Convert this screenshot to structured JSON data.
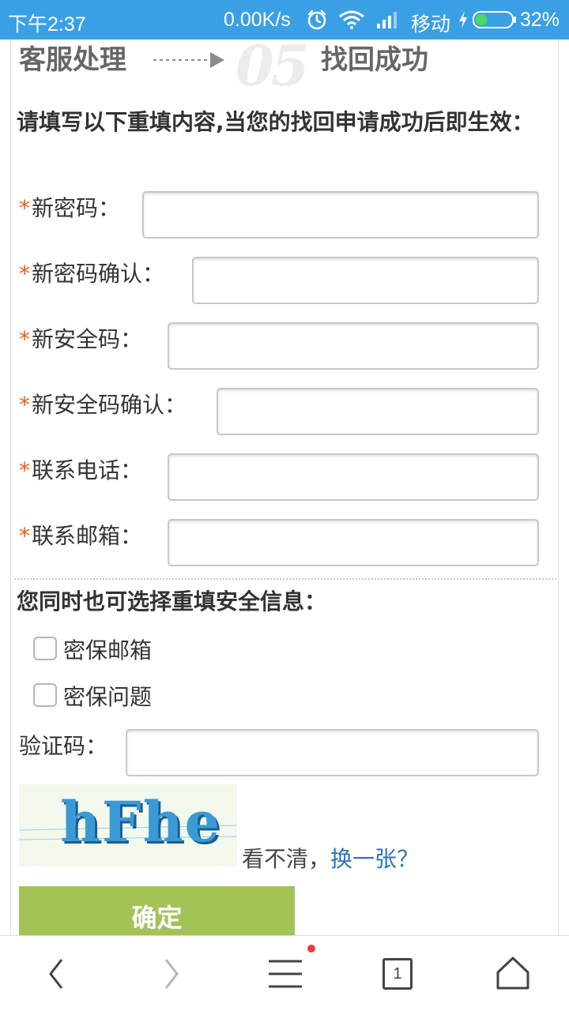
{
  "status_bar": {
    "time": "下午2:37",
    "network_speed": "0.00K/s",
    "carrier": "移动",
    "battery": "32%",
    "icons": [
      "alarm-clock-icon",
      "wifi-icon",
      "signal-icon",
      "charging-icon",
      "battery-icon"
    ],
    "battery_level": 0.32,
    "battery_color": "#4cd964"
  },
  "steps": {
    "previous": "客服处理",
    "number": "05",
    "current": "找回成功"
  },
  "form": {
    "intro": "请填写以下重填内容,当您的找回申请成功后即生效：",
    "required_mark": "*",
    "fields": [
      {
        "label": "新密码：",
        "value": ""
      },
      {
        "label": "新密码确认：",
        "value": ""
      },
      {
        "label": "新安全码：",
        "value": ""
      },
      {
        "label": "新安全码确认：",
        "value": ""
      },
      {
        "label": "联系电话：",
        "value": ""
      },
      {
        "label": "联系邮箱：",
        "value": ""
      }
    ]
  },
  "optional": {
    "title": "您同时也可选择重填安全信息：",
    "options": [
      {
        "label": "密保邮箱",
        "checked": false
      },
      {
        "label": "密保问题",
        "checked": false
      }
    ]
  },
  "captcha": {
    "label": "验证码：",
    "value": "",
    "image_text": "hFhe",
    "unclear_text": "看不清，",
    "change_link": "换一张？"
  },
  "submit_label": "确定",
  "bottom_bar": {
    "tab_count": "1",
    "icons": [
      "back-icon",
      "forward-icon",
      "menu-icon",
      "tabs-icon",
      "home-icon"
    ]
  },
  "colors": {
    "status_bar": "#3aa0e6",
    "required_star": "#e8601c",
    "submit_button": "#a4c356",
    "link": "#2f72b8",
    "notification_dot": "#ef3b3b"
  }
}
